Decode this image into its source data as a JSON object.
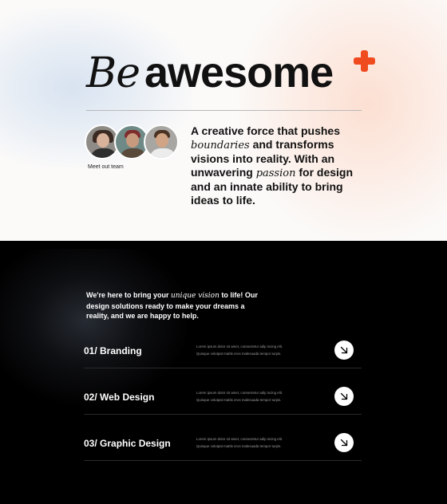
{
  "hero": {
    "headline_word1": "Be",
    "headline_word2": "awesome",
    "accent_color": "#f04a1f",
    "plus_icon": "plus-icon",
    "team_label": "Meet out team",
    "desc": {
      "p1": "A creative force that pushes ",
      "em1": "boundaries",
      "p2": " and transforms visions into reality. With an unwavering ",
      "em2": "passion",
      "p3": " for design and an innate ability to bring ideas to life."
    }
  },
  "services_section": {
    "intro": {
      "p1": "We're here to bring your ",
      "em": "unique vision",
      "p2": " to life! Our design solutions ready to make your dreams a reality, and we are happy to help."
    },
    "items": [
      {
        "title": "01/ Branding",
        "desc_line1": "Lorem ipsum dolor sit amet, consectetur adip iscing elit.",
        "desc_line2": "Quisque volutpat mattis eros malesuada tempor turpis."
      },
      {
        "title": "02/ Web Design",
        "desc_line1": "Lorem ipsum dolor sit amet, consectetur adip iscing elit.",
        "desc_line2": "Quisque volutpat mattis eros malesuada tempor turpis."
      },
      {
        "title": "03/ Graphic Design",
        "desc_line1": "Lorem ipsum dolor sit amet, consectetur adip iscing elit.",
        "desc_line2": "Quisque volutpat mattis eros malesuada tempor turpis."
      }
    ],
    "arrow_icon": "arrow-down-right-icon"
  }
}
